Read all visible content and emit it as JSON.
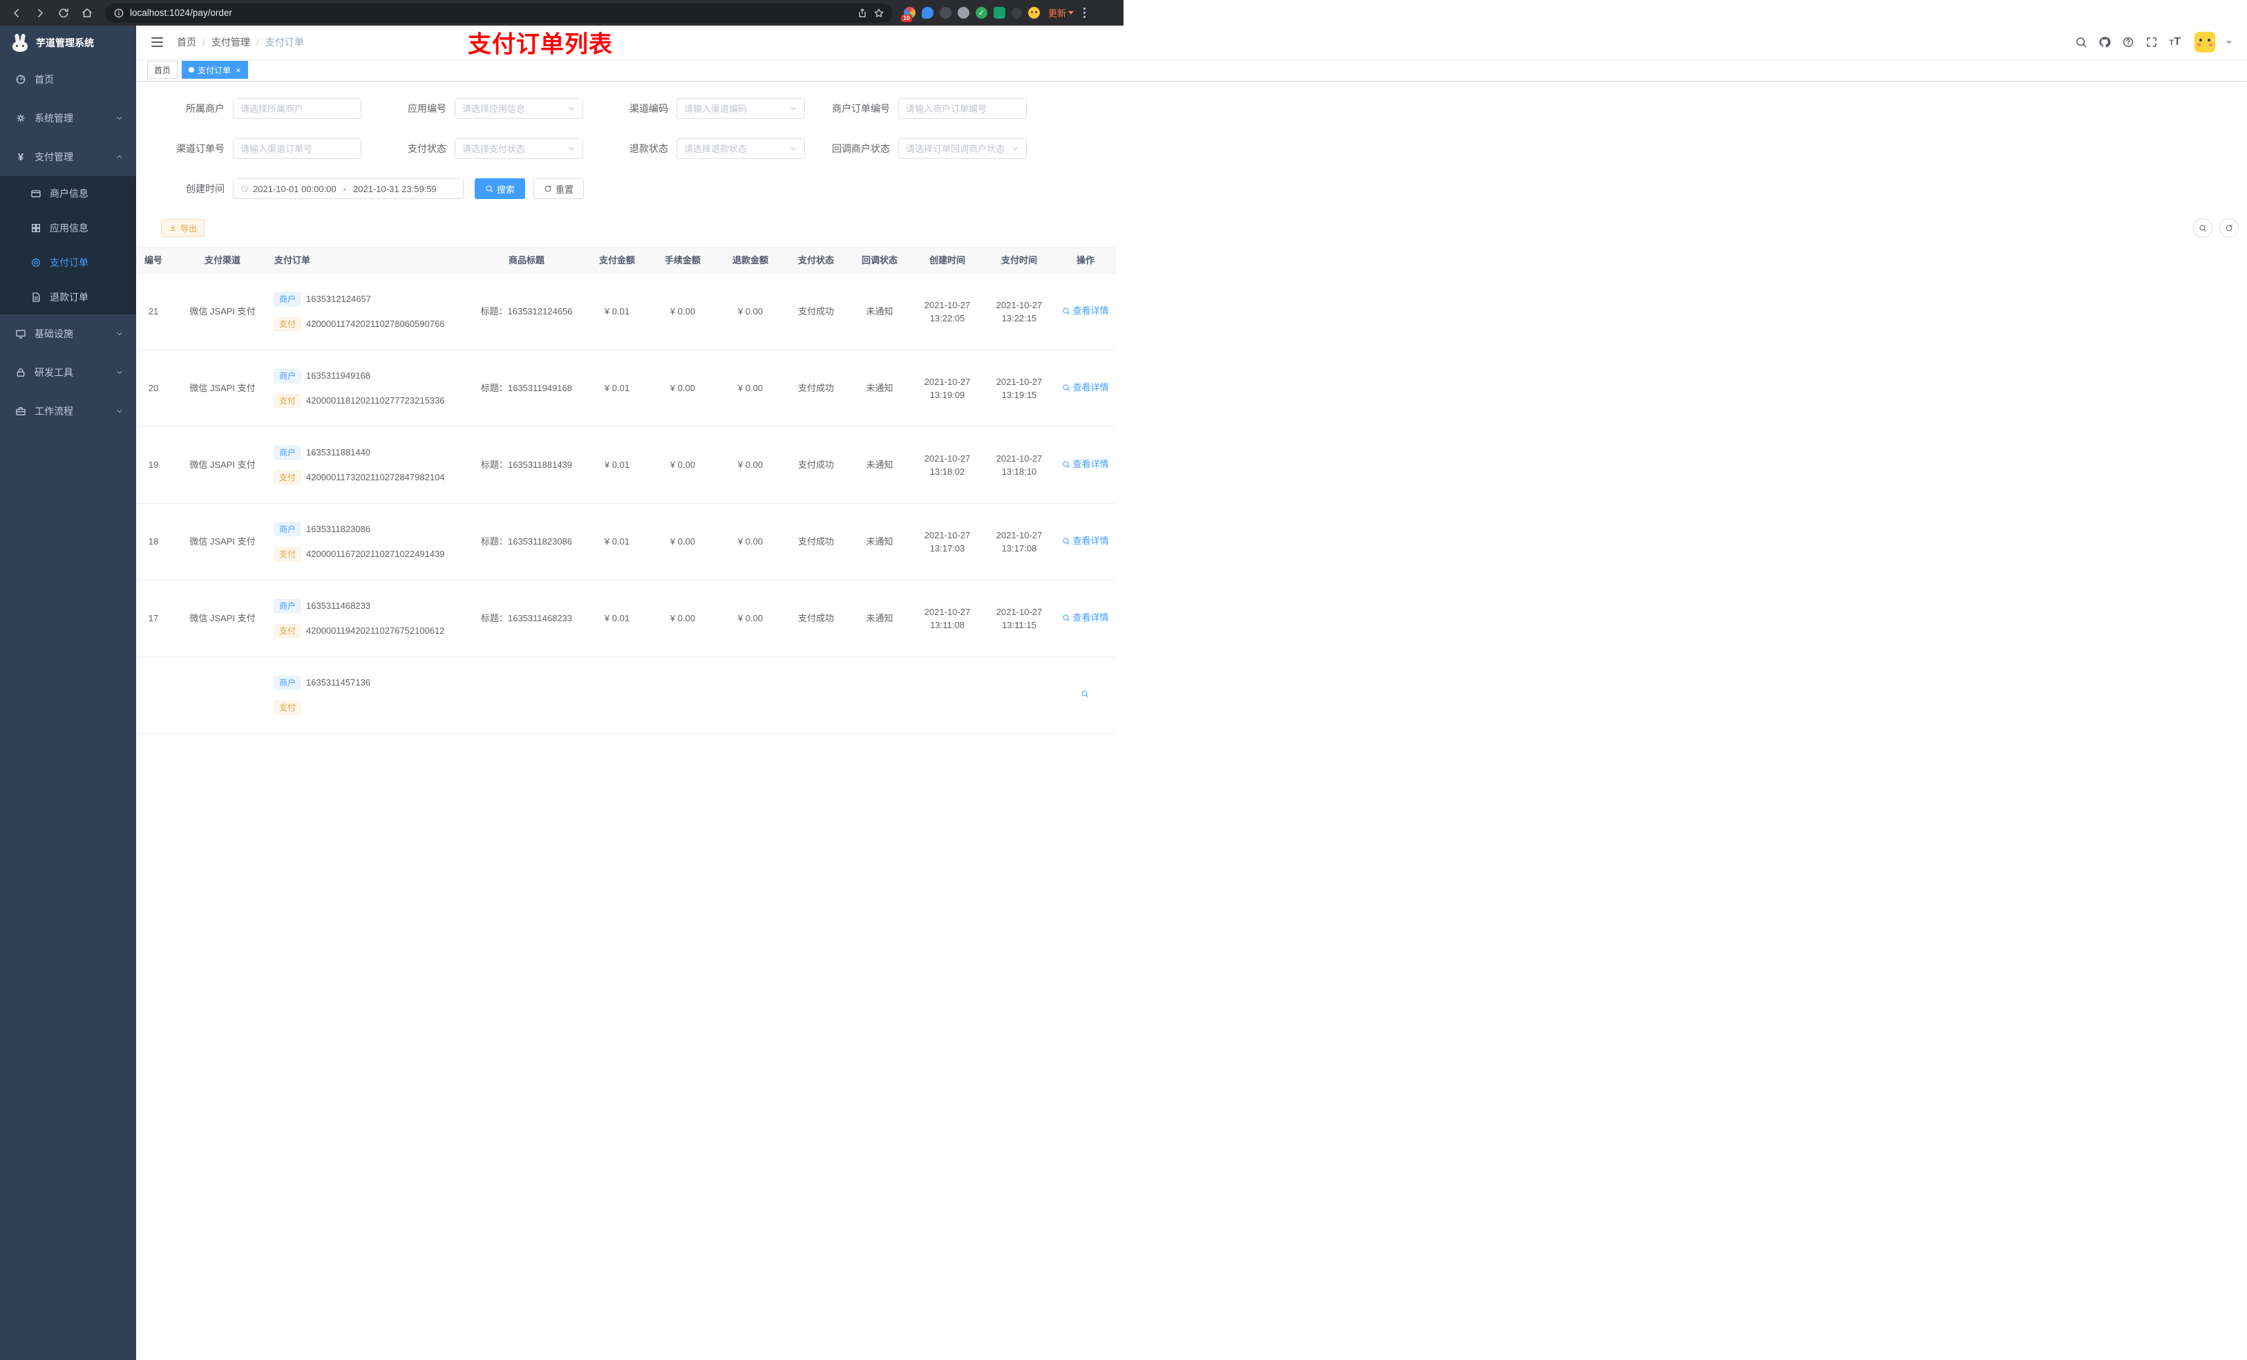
{
  "colors": {
    "primary": "#409eff",
    "warning": "#e6a23c",
    "annotation_red": "#ff0000",
    "sidebar_bg": "#304156"
  },
  "icons": [
    "back-icon",
    "forward-icon",
    "reload-icon",
    "home-icon",
    "info-icon",
    "share-icon",
    "star-icon",
    "extension-icon",
    "kebab-menu-icon",
    "hamburger-icon",
    "search-icon",
    "github-icon",
    "question-icon",
    "fullscreen-icon",
    "font-size-icon",
    "chevron-down-icon",
    "chevron-up-icon",
    "clock-icon",
    "download-icon",
    "refresh-icon",
    "magnifier-icon",
    "close-icon"
  ],
  "browser": {
    "url": "localhost:1024/pay/order",
    "ext_badge": "10",
    "update_label": "更新"
  },
  "sidebar": {
    "title": "芋道管理系统",
    "menu_top": [
      {
        "label": "首页"
      },
      {
        "label": "系统管理"
      }
    ],
    "payment": {
      "label": "支付管理",
      "children": [
        {
          "label": "商户信息"
        },
        {
          "label": "应用信息"
        },
        {
          "label": "支付订单"
        },
        {
          "label": "退款订单"
        }
      ]
    },
    "menu_bottom": [
      {
        "label": "基础设施"
      },
      {
        "label": "研发工具"
      },
      {
        "label": "工作流程"
      }
    ]
  },
  "header": {
    "breadcrumb": [
      "首页",
      "支付管理",
      "支付订单"
    ],
    "breadcrumb_sep": "/",
    "annotation": "支付订单列表"
  },
  "tabs": [
    {
      "label": "首页"
    },
    {
      "label": "支付订单",
      "active": true
    }
  ],
  "filters": {
    "fields": [
      {
        "label": "所属商户",
        "placeholder": "请选择所属商户"
      },
      {
        "label": "应用编号",
        "placeholder": "请选择应用信息"
      },
      {
        "label": "渠道编码",
        "placeholder": "请输入渠道编码"
      },
      {
        "label": "商户订单编号",
        "placeholder": "请输入商户订单编号"
      },
      {
        "label": "渠道订单号",
        "placeholder": "请输入渠道订单号"
      },
      {
        "label": "支付状态",
        "placeholder": "请选择支付状态"
      },
      {
        "label": "退款状态",
        "placeholder": "请选择退款状态"
      },
      {
        "label": "回调商户状态",
        "placeholder": "请选择订单回调商户状态"
      }
    ],
    "date": {
      "label": "创建时间",
      "start": "2021-10-01 00:00:00",
      "separator": "-",
      "end": "2021-10-31 23:59:59"
    },
    "search_label": "搜索",
    "reset_label": "重置"
  },
  "toolbar": {
    "export_label": "导出"
  },
  "table": {
    "headers": [
      "编号",
      "支付渠道",
      "支付订单",
      "商品标题",
      "支付金额",
      "手续金额",
      "退款金额",
      "支付状态",
      "回调状态",
      "创建时间",
      "支付时间",
      "操作"
    ],
    "rows": [
      {
        "id": "21",
        "channel": "微信 JSAPI 支付",
        "merchant_tag": "商户",
        "merchant_no": "1635312124657",
        "pay_tag": "支付",
        "pay_no": "4200001174202110278060590766",
        "title": "标题：1635312124656",
        "amount": "¥ 0.01",
        "fee": "¥ 0.00",
        "refund": "¥ 0.00",
        "status": "支付成功",
        "notify": "未通知",
        "create_date": "2021-10-27",
        "create_time": "13:22:05",
        "pay_date": "2021-10-27",
        "pay_time": "13:22:15",
        "action": "查看详情"
      },
      {
        "id": "20",
        "channel": "微信 JSAPI 支付",
        "merchant_tag": "商户",
        "merchant_no": "1635311949168",
        "pay_tag": "支付",
        "pay_no": "4200001181202110277723215336",
        "title": "标题：1635311949168",
        "amount": "¥ 0.01",
        "fee": "¥ 0.00",
        "refund": "¥ 0.00",
        "status": "支付成功",
        "notify": "未通知",
        "create_date": "2021-10-27",
        "create_time": "13:19:09",
        "pay_date": "2021-10-27",
        "pay_time": "13:19:15",
        "action": "查看详情"
      },
      {
        "id": "19",
        "channel": "微信 JSAPI 支付",
        "merchant_tag": "商户",
        "merchant_no": "1635311881440",
        "pay_tag": "支付",
        "pay_no": "4200001173202110272847982104",
        "title": "标题：1635311881439",
        "amount": "¥ 0.01",
        "fee": "¥ 0.00",
        "refund": "¥ 0.00",
        "status": "支付成功",
        "notify": "未通知",
        "create_date": "2021-10-27",
        "create_time": "13:18:02",
        "pay_date": "2021-10-27",
        "pay_time": "13:18:10",
        "action": "查看详情"
      },
      {
        "id": "18",
        "channel": "微信 JSAPI 支付",
        "merchant_tag": "商户",
        "merchant_no": "1635311823086",
        "pay_tag": "支付",
        "pay_no": "4200001167202110271022491439",
        "title": "标题：1635311823086",
        "amount": "¥ 0.01",
        "fee": "¥ 0.00",
        "refund": "¥ 0.00",
        "status": "支付成功",
        "notify": "未通知",
        "create_date": "2021-10-27",
        "create_time": "13:17:03",
        "pay_date": "2021-10-27",
        "pay_time": "13:17:08",
        "action": "查看详情"
      },
      {
        "id": "17",
        "channel": "微信 JSAPI 支付",
        "merchant_tag": "商户",
        "merchant_no": "1635311468233",
        "pay_tag": "支付",
        "pay_no": "4200001194202110276752100612",
        "title": "标题：1635311468233",
        "amount": "¥ 0.01",
        "fee": "¥ 0.00",
        "refund": "¥ 0.00",
        "status": "支付成功",
        "notify": "未通知",
        "create_date": "2021-10-27",
        "create_time": "13:11:08",
        "pay_date": "2021-10-27",
        "pay_time": "13:11:15",
        "action": "查看详情"
      },
      {
        "id": "",
        "channel": "",
        "merchant_tag": "商户",
        "merchant_no": "1635311457136",
        "pay_tag": "支付",
        "pay_no": "",
        "title": "",
        "amount": "",
        "fee": "",
        "refund": "",
        "status": "",
        "notify": "",
        "create_date": "",
        "create_time": "",
        "pay_date": "",
        "pay_time": "",
        "action": ""
      }
    ]
  }
}
